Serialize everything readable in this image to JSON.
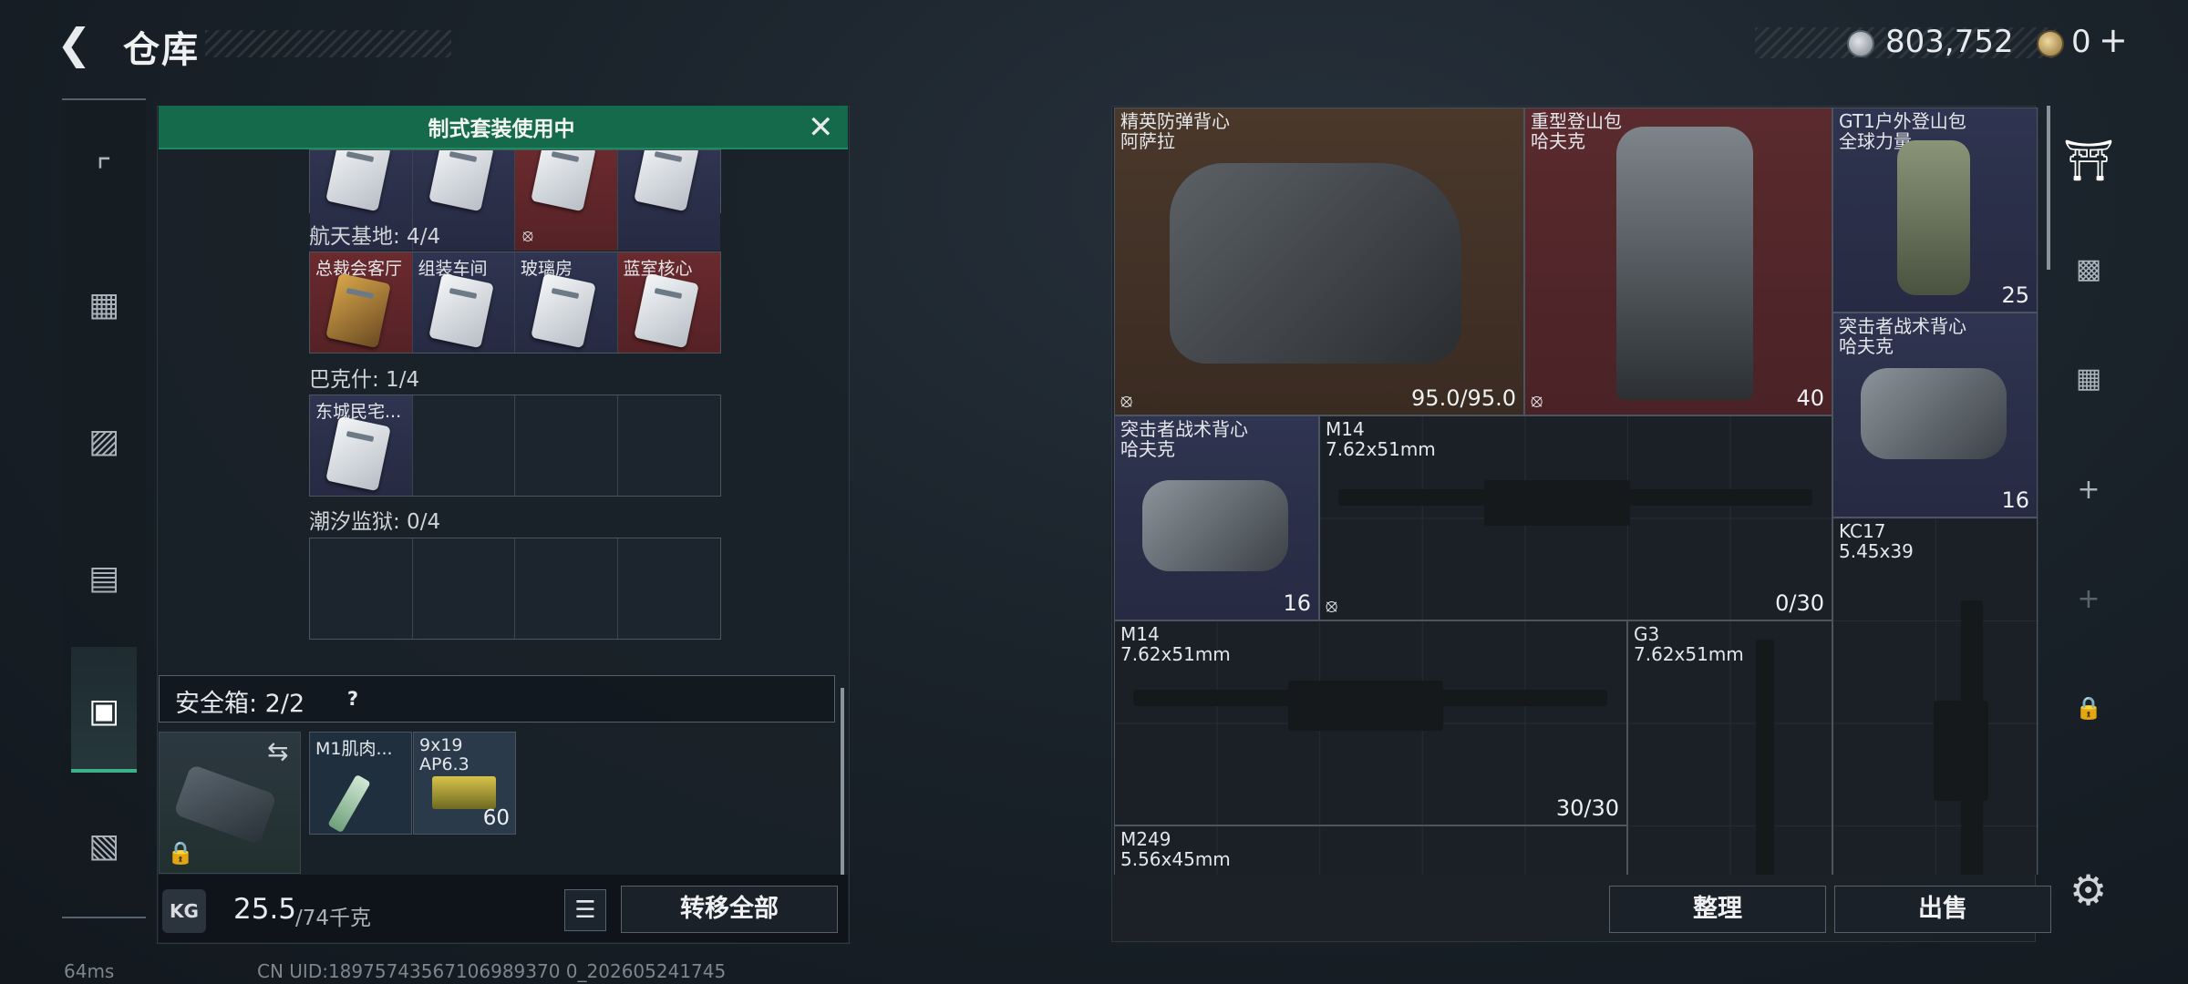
{
  "header": {
    "title": "仓库",
    "back_icon": "back-arrow-icon"
  },
  "currency": {
    "silver": "803,752",
    "gold": "0",
    "plus": "+"
  },
  "nav": {
    "items": [
      "pistol-icon",
      "vest-icon",
      "armor-icon",
      "backpack-icon",
      "container-icon",
      "toolbox-icon"
    ],
    "active_index": 4,
    "accent": "#3db28a"
  },
  "banner": {
    "text": "制式套装使用中",
    "color": "#146a4a"
  },
  "sections": [
    {
      "label": "航天基地: 4/4",
      "slots": [
        "总裁会客厅",
        "组装车间",
        "玻璃房",
        "蓝室核心"
      ]
    },
    {
      "label": "巴克什: 1/4",
      "slots": [
        "东城民宅..."
      ]
    },
    {
      "label": "潮汐监狱: 0/4",
      "slots": []
    }
  ],
  "safe": {
    "label": "安全箱: 2/2",
    "help": "?",
    "items": [
      {
        "name": "M1肌肉..."
      },
      {
        "name": "9x19",
        "sub": "AP6.3",
        "count": "60"
      }
    ]
  },
  "weight": {
    "current": "25.5",
    "max": "/74千克",
    "kg": "KG"
  },
  "buttons": {
    "transfer_all": "转移全部",
    "organize": "整理",
    "sell": "出售"
  },
  "items": [
    {
      "name": "精英防弹背心",
      "sub": "阿萨拉",
      "value": "95.0/95.0"
    },
    {
      "name": "重型登山包",
      "sub": "哈夫克",
      "value": "40"
    },
    {
      "name": "GT1户外登山包",
      "sub": "全球力量",
      "value": "25"
    },
    {
      "name": "突击者战术背心",
      "sub": "哈夫克",
      "value": "16"
    },
    {
      "name": "突击者战术背心",
      "sub": "哈夫克",
      "value": "16"
    },
    {
      "name": "M14",
      "sub": "7.62x51mm",
      "value": "0/30"
    },
    {
      "name": "KC17",
      "sub": "5.45x39",
      "value": ""
    },
    {
      "name": "M14",
      "sub": "7.62x51mm",
      "value": "30/30"
    },
    {
      "name": "G3",
      "sub": "7.62x51mm",
      "value": ""
    },
    {
      "name": "M249",
      "sub": "5.56x45mm",
      "value": ""
    }
  ],
  "status": {
    "ping": "64ms",
    "uid": "CN UID:18975743567106989370 0_202605241745"
  }
}
